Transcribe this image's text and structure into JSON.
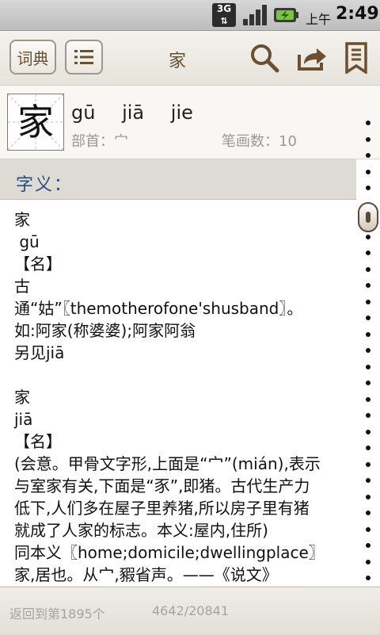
{
  "status_bar": {
    "network": "3G",
    "ampm": "上午",
    "time": "2:49"
  },
  "toolbar": {
    "dict_label": "词典",
    "title": "家",
    "icons": [
      "list-icon",
      "search-icon",
      "share-icon",
      "bookmark-icon"
    ]
  },
  "header": {
    "character": "家",
    "pinyin": [
      "gū",
      "jiā",
      "jie"
    ],
    "radical": "部首：宀",
    "strokes": "笔画数：10"
  },
  "section": {
    "title": "字义："
  },
  "body_lines": [
    "家",
    " gū",
    "【名】",
    "古",
    "通“姑”〖themotherofone'shusband〗。",
    "如:阿家(称婆婆);阿家阿翁",
    "另见jiā",
    "",
    "家",
    "jiā",
    "【名】",
    "(会意。甲骨文字形,上面是“宀”(mián),表示",
    "与室家有关,下面是“豕”,即猪。古代生产力",
    "低下,人们多在屋子里养猪,所以房子里有猪",
    "就成了人家的标志。本义:屋内,住所)",
    "同本义〖home;domicile;dwellingplace〗",
    "家,居也。从宀,豭省声。——《说文》"
  ],
  "footer": {
    "back_label": "返回到第1895个",
    "position": "4642/20841"
  },
  "colors": {
    "accent_brown": "#6b4f2f",
    "section_title": "#2a4f78"
  }
}
